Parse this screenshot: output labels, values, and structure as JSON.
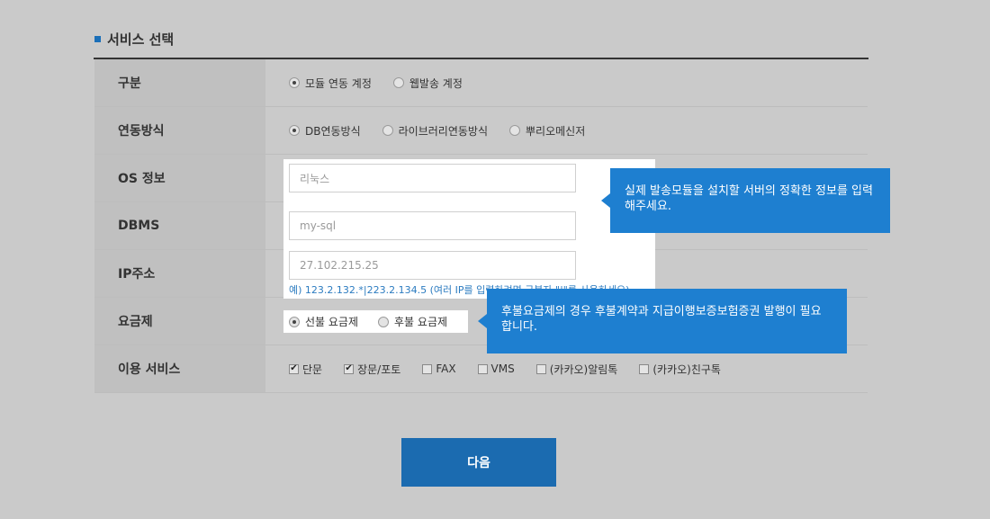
{
  "section": {
    "title": "서비스 선택"
  },
  "rows": {
    "type": {
      "label": "구분",
      "options": [
        "모듈 연동 계정",
        "웹발송 계정"
      ]
    },
    "method": {
      "label": "연동방식",
      "options": [
        "DB연동방식",
        "라이브러리연동방식",
        "뿌리오메신저"
      ]
    },
    "os": {
      "label": "OS 정보",
      "value": "리눅스"
    },
    "dbms": {
      "label": "DBMS",
      "value": "my-sql"
    },
    "ip": {
      "label": "IP주소",
      "value": "27.102.215.25",
      "hint": "예) 123.2.132.*|223.2.134.5 (여러 IP를 입력하려면 구분자 \"|\"를 사용하세요)"
    },
    "fee": {
      "label": "요금제",
      "options": [
        "선불 요금제",
        "후불 요금제"
      ]
    },
    "services": {
      "label": "이용 서비스",
      "options": [
        "단문",
        "장문/포토",
        "FAX",
        "VMS",
        "(카카오)알림톡",
        "(카카오)친구톡"
      ],
      "checked": [
        true,
        true,
        false,
        false,
        false,
        false
      ]
    }
  },
  "tooltips": {
    "server": "실제 발송모듈을 설치할 서버의 정확한 정보를 입력해주세요.",
    "postpaid": "후불요금제의 경우 후불계약과 지급이행보증보험증권 발행이 필요합니다."
  },
  "buttons": {
    "next": "다음"
  },
  "colors": {
    "accent": "#1b6bb0",
    "tooltip": "#1e7fd0",
    "hint": "#2b7bc0"
  }
}
